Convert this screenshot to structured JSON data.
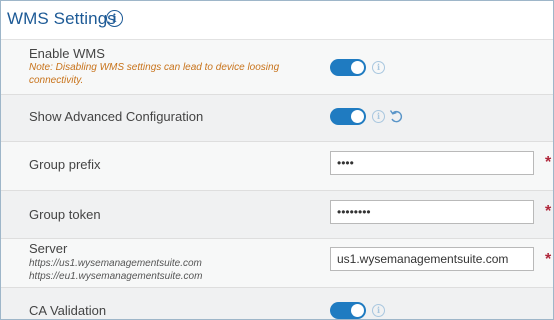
{
  "header": {
    "title": "WMS Settings"
  },
  "rows": {
    "enable_wms": {
      "label": "Enable WMS",
      "note": "Note: Disabling WMS settings can lead to device loosing connectivity.",
      "toggle_on": true
    },
    "advanced": {
      "label": "Show Advanced Configuration",
      "toggle_on": true
    },
    "group_prefix": {
      "label": "Group prefix",
      "value": "••••",
      "required": "*"
    },
    "group_token": {
      "label": "Group token",
      "value": "••••••••",
      "required": "*"
    },
    "server": {
      "label": "Server",
      "hint1": "https://us1.wysemanagementsuite.com",
      "hint2": "https://eu1.wysemanagementsuite.com",
      "value": "us1.wysemanagementsuite.com",
      "required": "*"
    },
    "ca_validation": {
      "label": "CA Validation",
      "toggle_on": true
    }
  },
  "icons": {
    "info": "info-icon",
    "reset": "undo-icon"
  },
  "colors": {
    "accent": "#1f7bc1",
    "title": "#1d5a96",
    "note": "#c8731b",
    "required": "#b0273b"
  }
}
